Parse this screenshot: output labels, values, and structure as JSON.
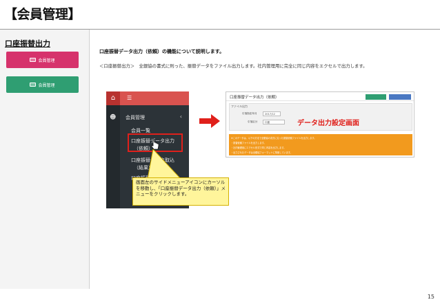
{
  "slide": {
    "title": "【会員管理】",
    "page_number": "15"
  },
  "left_panel": {
    "heading": "口座振替出力",
    "buttons": [
      {
        "label": "会員管理",
        "color": "#d6336c"
      },
      {
        "label": "会員管理",
        "color": "#2f9e72"
      }
    ]
  },
  "description": {
    "title": "口座振替データ出力（依頼）の機能について説明します。",
    "body": "＜口座振替出力＞　全銀協の書式に則った、振替データをファイル出力します。社内管理用に完全に同じ内容をエクセルで出力します。"
  },
  "screenshot_menu": {
    "section": "会員管理",
    "items": [
      "会員一覧",
      "口座振替データ出力",
      "（依頼）",
      "口座振替データ取込",
      "（結果）",
      "口座振替データ"
    ]
  },
  "screenshot_form": {
    "title": "口座振替データ出力（依頼）",
    "form_heading": "ファイル出力",
    "field_labels": [
      "引落指定年月",
      "引落区分"
    ],
    "field_values": [
      "2017/12",
      "口座"
    ],
    "caption": "データ出力設定画面",
    "notes": [
      "※このデータは、以下の方法で全銀協の書式に沿った振替依頼ファイルを出力します。",
      "・振替依頼ファイルを出力します。",
      "・社内管理用にエクセル形式で同じ内容を出力します。",
      "・出力されたデータは全銀協フォーマットに準拠しています。"
    ]
  },
  "callout": {
    "text": "画面左のサイドメニューアイコンにカーソルを移動し、「口座振替データ出力（依頼）」メニューをクリックします。"
  },
  "colors": {
    "accent_red": "#e0201b",
    "callout_bg": "#fff59b",
    "note_orange": "#f29a1e"
  }
}
